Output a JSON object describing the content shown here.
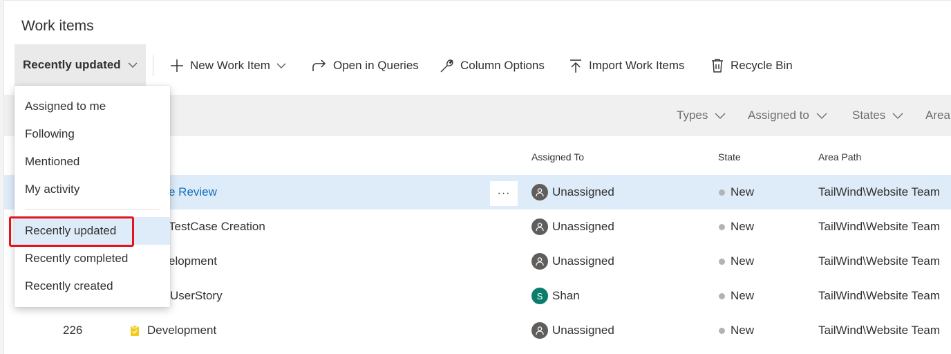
{
  "page": {
    "title": "Work items"
  },
  "toolbar": {
    "view_picker": "Recently updated",
    "new_work_item": "New Work Item",
    "open_in_queries": "Open in Queries",
    "column_options": "Column Options",
    "import_work_items": "Import Work Items",
    "recycle_bin": "Recycle Bin"
  },
  "filters": {
    "types": "Types",
    "assigned_to": "Assigned to",
    "states": "States",
    "area": "Area"
  },
  "columns": {
    "assigned_to": "Assigned To",
    "state": "State",
    "area_path": "Area Path"
  },
  "rows": [
    {
      "id": "",
      "title": "e Review",
      "assigned": "Unassigned",
      "state": "New",
      "area": "TailWind\\Website Team"
    },
    {
      "id": "",
      "title": "TestCase Creation",
      "assigned": "Unassigned",
      "state": "New",
      "area": "TailWind\\Website Team"
    },
    {
      "id": "",
      "title": "elopment",
      "assigned": "Unassigned",
      "state": "New",
      "area": "TailWind\\Website Team"
    },
    {
      "id": "",
      "title": "UserStory",
      "assigned": "Shan",
      "avatar_initial": "S",
      "state": "New",
      "area": "TailWind\\Website Team"
    },
    {
      "id": "226",
      "title": "Development",
      "assigned": "Unassigned",
      "state": "New",
      "area": "TailWind\\Website Team"
    }
  ],
  "row_more": "···",
  "dropdown": {
    "items": [
      "Assigned to me",
      "Following",
      "Mentioned",
      "My activity",
      "Recently updated",
      "Recently completed",
      "Recently created"
    ],
    "selected": "Recently updated"
  },
  "colors": {
    "accent": "#106ebe",
    "selected_bg": "#deecf9",
    "highlight": "#e3121c",
    "task_icon": "#f2cb1d",
    "avatar_shan": "#0a7d6d"
  }
}
